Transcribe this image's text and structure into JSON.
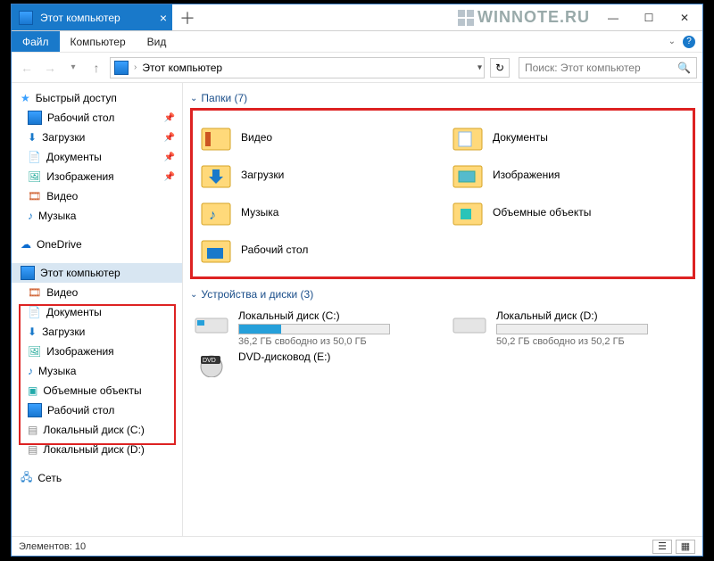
{
  "watermark": "WINNOTE.RU",
  "titlebar": {
    "tab_title": "Этот компьютер"
  },
  "menu": {
    "file": "Файл",
    "computer": "Компьютер",
    "view": "Вид"
  },
  "nav": {
    "breadcrumb": "Этот компьютер",
    "search_placeholder": "Поиск: Этот компьютер"
  },
  "sidebar": {
    "quick_access": "Быстрый доступ",
    "qa_items": [
      {
        "label": "Рабочий стол"
      },
      {
        "label": "Загрузки"
      },
      {
        "label": "Документы"
      },
      {
        "label": "Изображения"
      },
      {
        "label": "Видео"
      },
      {
        "label": "Музыка"
      }
    ],
    "onedrive": "OneDrive",
    "this_pc": "Этот компьютер",
    "pc_items": [
      {
        "label": "Видео"
      },
      {
        "label": "Документы"
      },
      {
        "label": "Загрузки"
      },
      {
        "label": "Изображения"
      },
      {
        "label": "Музыка"
      },
      {
        "label": "Объемные объекты"
      },
      {
        "label": "Рабочий стол"
      }
    ],
    "drive_c": "Локальный диск (C:)",
    "drive_d": "Локальный диск (D:)",
    "network": "Сеть"
  },
  "content": {
    "folders_header": "Папки (7)",
    "folders": [
      {
        "label": "Видео"
      },
      {
        "label": "Документы"
      },
      {
        "label": "Загрузки"
      },
      {
        "label": "Изображения"
      },
      {
        "label": "Музыка"
      },
      {
        "label": "Объемные объекты"
      },
      {
        "label": "Рабочий стол"
      }
    ],
    "drives_header": "Устройства и диски (3)",
    "drive_c": {
      "label": "Локальный диск (C:)",
      "sub": "36,2 ГБ свободно из 50,0 ГБ",
      "fill": 28
    },
    "drive_d": {
      "label": "Локальный диск (D:)",
      "sub": "50,2 ГБ свободно из 50,2 ГБ",
      "fill": 0
    },
    "dvd": {
      "label": "DVD-дисковод (E:)"
    }
  },
  "status": {
    "label": "Элементов:",
    "count": "10"
  }
}
